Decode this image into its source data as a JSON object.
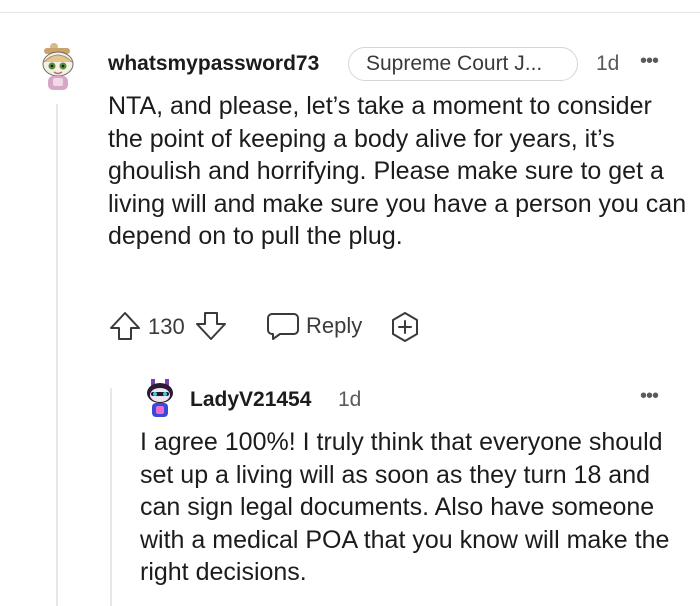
{
  "comment": {
    "username": "whatsmypassword73",
    "flair": "Supreme Court J...",
    "time": "1d",
    "more": "•••",
    "body": "NTA, and please, let’s take a moment to consider the point of keeping a body alive for years, it’s ghoulish and horrifying. Please make sure to get a living will and make sure you have a person you can depend on to pull the plug.",
    "score": "130",
    "reply_label": "Reply",
    "icons": {
      "avatar": "snoo-avatar-icon",
      "upvote": "upvote-arrow-icon",
      "downvote": "downvote-arrow-icon",
      "reply": "speech-bubble-icon",
      "award": "award-plus-icon"
    }
  },
  "reply": {
    "username": "LadyV21454",
    "time": "1d",
    "more": "•••",
    "body": "I agree 100%! I truly think that everyone should set up a living will as soon as they turn 18 and can sign legal documents. Also have someone with a medical POA that you know will make the right decisions.",
    "icons": {
      "avatar": "snoo-avatar-icon"
    }
  },
  "colors": {
    "text": "#1c1c1c",
    "meta": "#5a5a5a",
    "border": "#d6d6d6",
    "thread_line": "#e8e8e8"
  }
}
